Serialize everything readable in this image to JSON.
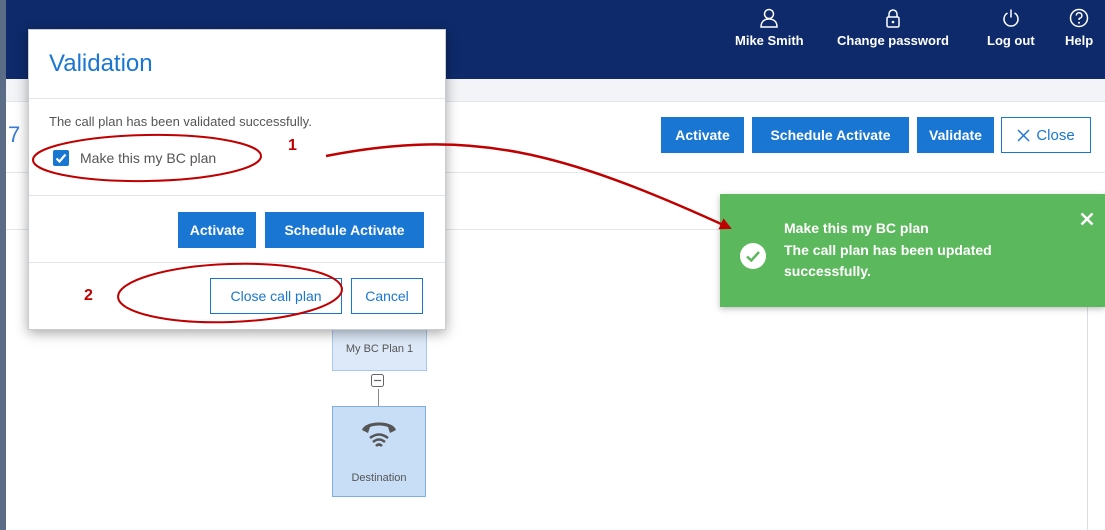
{
  "header": {
    "nav": [
      {
        "label": "Mike Smith",
        "icon": "user-icon"
      },
      {
        "label": "Change password",
        "icon": "lock-icon"
      },
      {
        "label": "Log out",
        "icon": "power-icon"
      },
      {
        "label": "Help",
        "icon": "help-icon"
      }
    ]
  },
  "page": {
    "title_fragment": "7"
  },
  "toolbar": {
    "activate": "Activate",
    "schedule_activate": "Schedule Activate",
    "validate": "Validate",
    "close": "Close"
  },
  "canvas": {
    "plan_node_label": "My BC Plan 1",
    "destination_label": "Destination"
  },
  "modal": {
    "title": "Validation",
    "message": "The call plan has been validated successfully.",
    "checkbox_label": "Make this my BC plan",
    "checkbox_checked": true,
    "activate": "Activate",
    "schedule_activate": "Schedule Activate",
    "close_call_plan": "Close call plan",
    "cancel": "Cancel"
  },
  "annotations": {
    "step1": "1",
    "step2": "2"
  },
  "toast": {
    "title": "Make this my BC plan",
    "message": "The call plan has been updated successfully."
  },
  "colors": {
    "header_bg": "#0e2a6b",
    "accent": "#1976d2",
    "success": "#5cb85c",
    "annotation": "#c00000"
  }
}
